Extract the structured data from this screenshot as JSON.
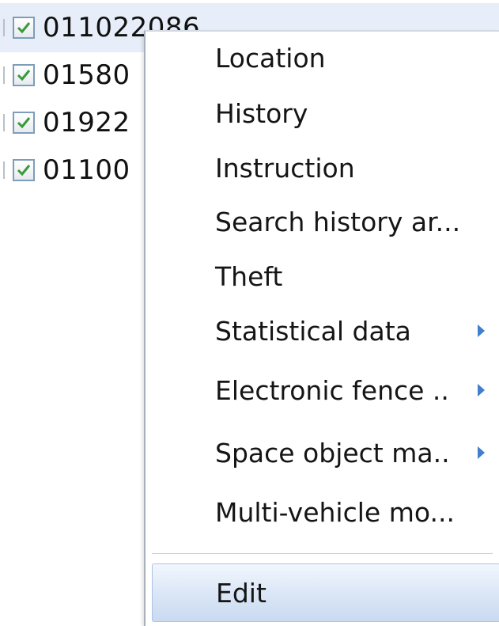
{
  "tree": {
    "rows": [
      {
        "label": "011022086",
        "checked": true,
        "selected": true
      },
      {
        "label": "01580",
        "checked": true,
        "selected": false
      },
      {
        "label": "01922",
        "checked": true,
        "selected": false
      },
      {
        "label": "01100",
        "checked": true,
        "selected": false
      }
    ]
  },
  "context_menu": {
    "items": [
      {
        "label": "Location",
        "has_submenu": false
      },
      {
        "label": "History",
        "has_submenu": false
      },
      {
        "label": "Instruction",
        "has_submenu": false
      },
      {
        "label": "Search history ar...",
        "has_submenu": false
      },
      {
        "label": "Theft",
        "has_submenu": false
      },
      {
        "label": "Statistical data",
        "has_submenu": true
      },
      {
        "label": "Electronic fence ..",
        "has_submenu": true
      },
      {
        "label": "Space object ma..",
        "has_submenu": true
      },
      {
        "label": "Multi-vehicle mo...",
        "has_submenu": false
      }
    ],
    "edit": {
      "label": "Edit",
      "hovered": true
    }
  },
  "colors": {
    "check_mark": "#3a9a3a",
    "submenu_arrow": "#3f7fce",
    "selected_row": "#e7eef9",
    "hover_item": "#c9daf1"
  }
}
